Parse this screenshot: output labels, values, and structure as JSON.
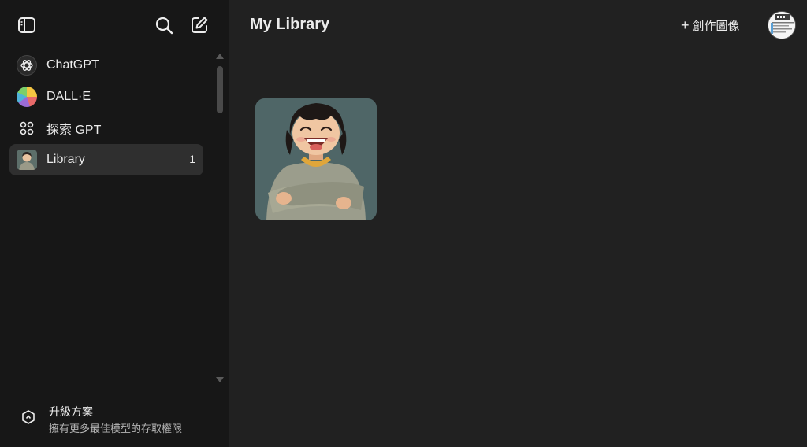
{
  "sidebar": {
    "items": [
      {
        "label": "ChatGPT",
        "icon": "openai-logo-icon"
      },
      {
        "label": "DALL·E",
        "icon": "dalle-logo-icon"
      },
      {
        "label": "探索 GPT",
        "icon": "grid-dots-icon"
      },
      {
        "label": "Library",
        "icon": "library-thumbnail",
        "count": "1",
        "active": true
      }
    ],
    "upgrade": {
      "title": "升級方案",
      "subtitle": "擁有更多最佳模型的存取權限"
    }
  },
  "header": {
    "title": "My Library",
    "create_label": "創作圖像",
    "create_icon": "plus-icon"
  },
  "library": {
    "images": [
      {
        "description": "laughing-child-in-gray-sweater"
      }
    ]
  },
  "colors": {
    "sidebar_bg": "#171717",
    "main_bg": "#212121",
    "active_item_bg": "#2f2f2f",
    "text": "#ececec",
    "muted_text": "#b4b4b4"
  }
}
